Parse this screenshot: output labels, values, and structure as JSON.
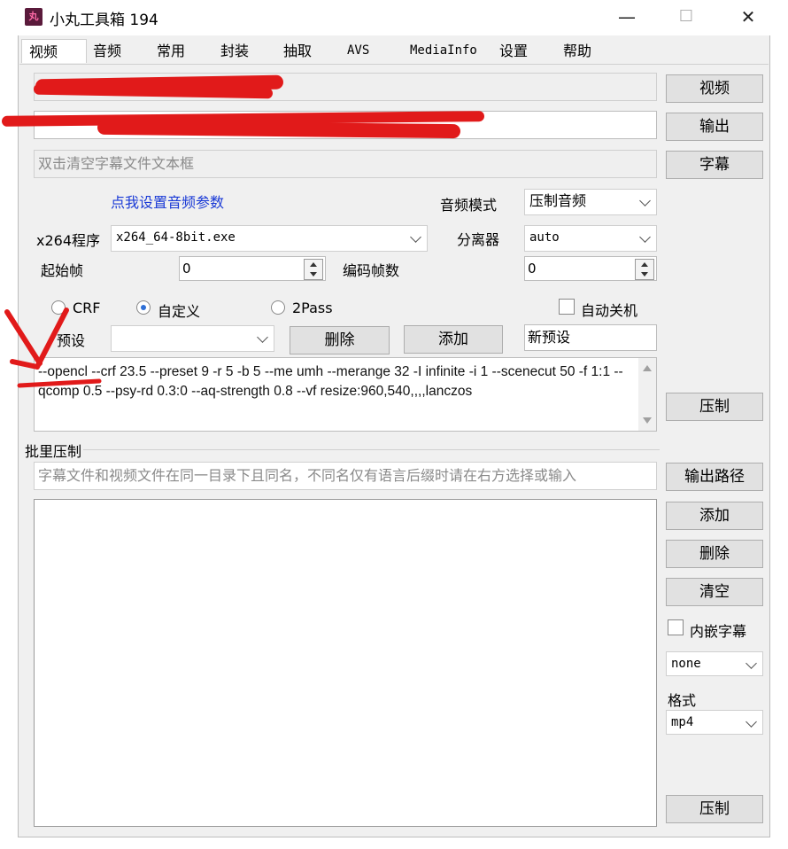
{
  "window": {
    "title": "小丸工具箱 194",
    "icon_text": "丸",
    "controls": {
      "minimize": "—",
      "maximize": "☐",
      "close": "✕"
    }
  },
  "tabs": [
    {
      "label": "视频",
      "active": true
    },
    {
      "label": "音频"
    },
    {
      "label": "常用"
    },
    {
      "label": "封装"
    },
    {
      "label": "抽取"
    },
    {
      "label": "AVS"
    },
    {
      "label": "MediaInfo"
    },
    {
      "label": "设置"
    },
    {
      "label": "帮助"
    }
  ],
  "video": {
    "video_button": "视频",
    "output_button": "输出",
    "subtitle_button": "字幕",
    "subtitle_placeholder": "双击清空字幕文件文本框",
    "audio_link": "点我设置音频参数",
    "audio_mode_label": "音频模式",
    "audio_mode_value": "压制音频",
    "x264_label": "x264程序",
    "x264_value": "x264_64-8bit.exe",
    "demuxer_label": "分离器",
    "demuxer_value": "auto",
    "start_frame_label": "起始帧",
    "start_frame_value": "0",
    "encode_frames_label": "编码帧数",
    "encode_frames_value": "0",
    "modes": [
      {
        "label": "CRF",
        "selected": false
      },
      {
        "label": "自定义",
        "selected": true
      },
      {
        "label": "2Pass",
        "selected": false
      }
    ],
    "auto_shutdown_label": "自动关机",
    "preset_label": "预设",
    "preset_value": "",
    "delete_button": "删除",
    "add_button": "添加",
    "new_preset_value": "新预设",
    "params_text": "--opencl --crf 23.5 --preset 9 -r 5 -b 5 --me umh --merange 32 -I infinite -i 1 --scenecut 50 -f 1:1 --qcomp 0.5 --psy-rd 0.3:0 --aq-strength 0.8 --vf resize:960,540,,,,lanczos",
    "encode_button": "压制"
  },
  "batch": {
    "group_label": "批里压制",
    "hint_placeholder": "字幕文件和视频文件在同一目录下且同名，不同名仅有语言后缀时请在右方选择或输入",
    "output_path_button": "输出路径",
    "add_button": "添加",
    "delete_button": "删除",
    "clear_button": "清空",
    "embed_subtitle_label": "内嵌字幕",
    "subtitle_lang_value": "none",
    "format_label": "格式",
    "format_value": "mp4",
    "encode_button": "压制"
  },
  "annotations": {
    "redaction_color": "#e11a1a"
  }
}
